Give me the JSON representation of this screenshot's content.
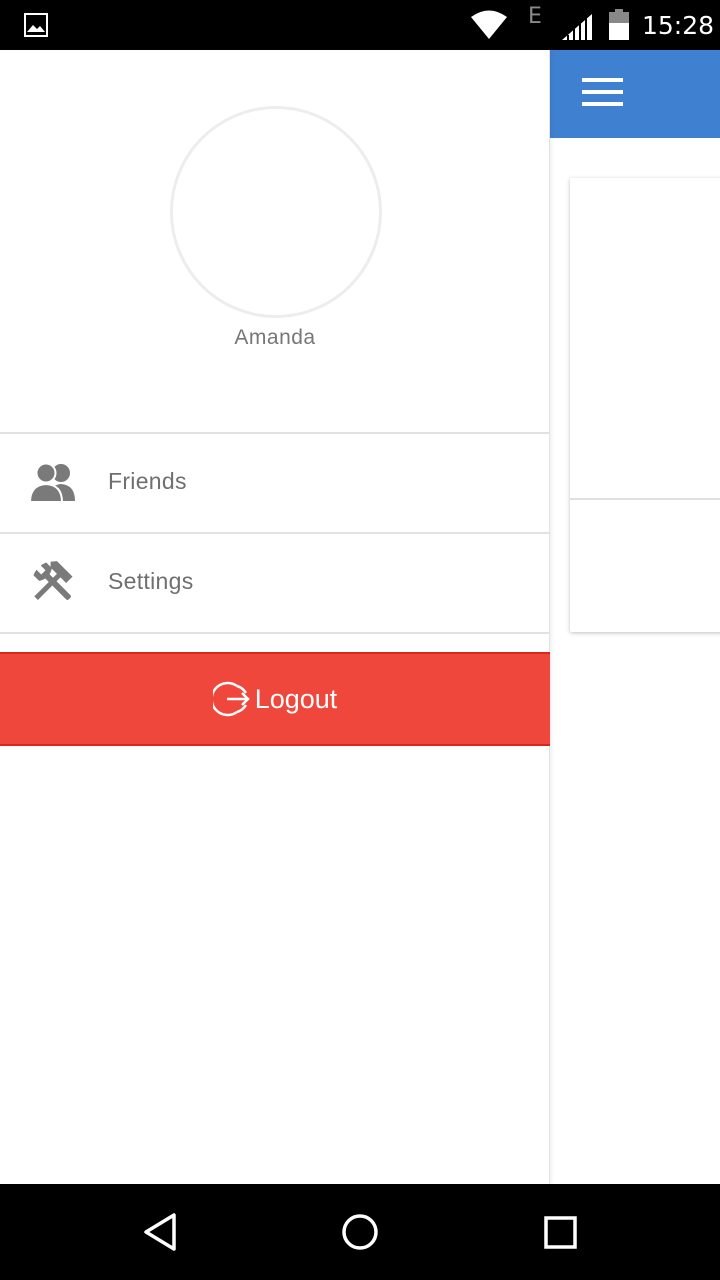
{
  "status_bar": {
    "network_type": "E",
    "time": "15:28",
    "icons": [
      "gallery-icon",
      "wifi-icon",
      "signal-icon",
      "battery-icon"
    ]
  },
  "drawer": {
    "user_name": "Amanda",
    "menu": [
      {
        "label": "Friends",
        "icon": "friends-icon"
      },
      {
        "label": "Settings",
        "icon": "settings-icon"
      }
    ],
    "logout_label": "Logout"
  },
  "main_app": {
    "app_bar_color": "#3f80d1",
    "menu_icon": "hamburger-menu-icon"
  },
  "nav_bar": {
    "buttons": [
      "back-icon",
      "home-icon",
      "recents-icon"
    ]
  },
  "colors": {
    "logout_bg": "#f0473d",
    "app_bar": "#3f80d1"
  }
}
